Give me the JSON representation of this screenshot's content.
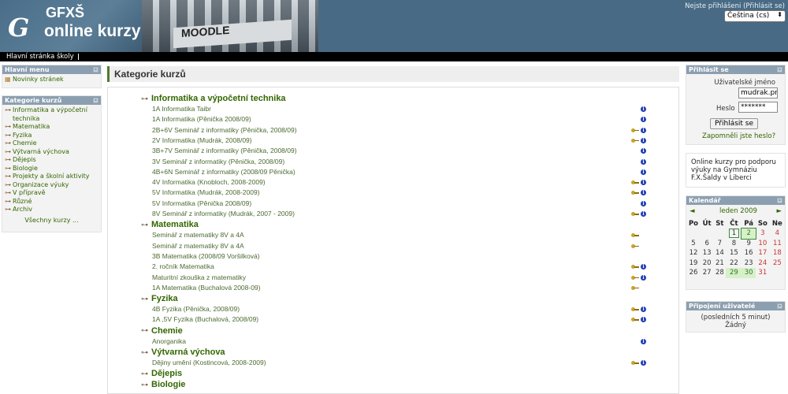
{
  "header": {
    "logo_line1": "GFXŠ",
    "logo_line2": "online kurzy",
    "logo_letter": "G",
    "photo_text": "MOODLE",
    "login_info": "Nejste přihlášeni (Přihlásit se)",
    "language": "Čeština (cs)"
  },
  "navbar": {
    "home_link": "Hlavní stránka školy"
  },
  "main_menu": {
    "title": "Hlavní menu",
    "items": [
      {
        "label": "Novinky stránek",
        "icon": "news-icon"
      }
    ]
  },
  "category_block": {
    "title": "Kategorie kurzů",
    "items": [
      "Informatika a výpočetní technika",
      "Matematika",
      "Fyzika",
      "Chemie",
      "Výtvarná výchova",
      "Dějepis",
      "Biologie",
      "Projekty a školní aktivity",
      "Organizace výuky",
      "V přípravě",
      "Různé",
      "Archiv"
    ],
    "all_courses": "Všechny kurzy ..."
  },
  "main": {
    "title": "Kategorie kurzů",
    "categories": [
      {
        "name": "Informatika a výpočetní technika",
        "courses": [
          {
            "name": "1A Informatika Taibr",
            "key": false,
            "info": true
          },
          {
            "name": "1A Informatika (Pěnička 2008/09)",
            "key": false,
            "info": true
          },
          {
            "name": "2B+6V Seminář z informatiky (Pěnička, 2008/09)",
            "key": true,
            "info": true
          },
          {
            "name": "2V Informatika (Mudrák, 2008/09)",
            "key": true,
            "info": true
          },
          {
            "name": "3B+7V Seminář z informatiky (Pěnička, 2008/09)",
            "key": false,
            "info": true
          },
          {
            "name": "3V Seminář z informatiky (Pěnička, 2008/09)",
            "key": false,
            "info": true
          },
          {
            "name": "4B+6N Seminář z informatiky (2008/09 Pěnička)",
            "key": false,
            "info": true
          },
          {
            "name": "4V Informatika (Knobloch, 2008-2009)",
            "key": true,
            "info": true
          },
          {
            "name": "5V Informatika (Mudrák, 2008-2009)",
            "key": true,
            "info": true
          },
          {
            "name": "5V Informatika (Pěnička 2008/09)",
            "key": false,
            "info": true
          },
          {
            "name": "8V Seminář z informatiky (Mudrák, 2007 - 2009)",
            "key": true,
            "info": true
          }
        ]
      },
      {
        "name": "Matematika",
        "courses": [
          {
            "name": "Seminář z matematiky 8V a 4A",
            "key": true,
            "info": false
          },
          {
            "name": "Seminář z matematiky 8V a 4A",
            "key": true,
            "info": false
          },
          {
            "name": "3B Matematika (2008/09 Voršilková)",
            "key": false,
            "info": false
          },
          {
            "name": "2. ročník Matematika",
            "key": true,
            "info": true
          },
          {
            "name": "Maturitní zkouška z matematiky",
            "key": true,
            "info": true
          },
          {
            "name": "1A Matematika (Buchalová 2008-09)",
            "key": true,
            "info": false
          }
        ]
      },
      {
        "name": "Fyzika",
        "courses": [
          {
            "name": "4B Fyzika (Pěnička, 2008/09)",
            "key": true,
            "info": true
          },
          {
            "name": "1A ,5V Fyzika (Buchalová, 2008/09)",
            "key": true,
            "info": true
          }
        ]
      },
      {
        "name": "Chemie",
        "courses": [
          {
            "name": "Anorganika",
            "key": false,
            "info": true
          }
        ]
      },
      {
        "name": "Výtvarná výchova",
        "courses": [
          {
            "name": "Dějiny umění (Kostincová, 2008-2009)",
            "key": true,
            "info": true
          }
        ]
      },
      {
        "name": "Dějepis",
        "courses": []
      },
      {
        "name": "Biologie",
        "courses": []
      }
    ]
  },
  "login_block": {
    "title": "Přihlásit se",
    "username_label": "Uživatelské jméno",
    "username_value": "mudrak.pr",
    "password_label": "Heslo",
    "password_value": "*******",
    "login_button": "Přihlásit se",
    "forgot_link": "Zapomněli jste heslo?"
  },
  "about_block": {
    "text": "Online kurzy pro podporu výuky na Gymnáziu F.X.Šaldy v Liberci"
  },
  "calendar": {
    "title": "Kalendář",
    "month": "leden 2009",
    "prev": "◄",
    "next": "►",
    "weekdays": [
      "Po",
      "Út",
      "St",
      "Čt",
      "Pá",
      "So",
      "Ne"
    ],
    "weeks": [
      [
        "",
        "",
        "",
        "1",
        "2",
        "3",
        "4"
      ],
      [
        "5",
        "6",
        "7",
        "8",
        "9",
        "10",
        "11"
      ],
      [
        "12",
        "13",
        "14",
        "15",
        "16",
        "17",
        "18"
      ],
      [
        "19",
        "20",
        "21",
        "22",
        "23",
        "24",
        "25"
      ],
      [
        "26",
        "27",
        "28",
        "29",
        "30",
        "31",
        ""
      ]
    ],
    "today": "1",
    "event_days": [
      "2",
      "29",
      "30"
    ]
  },
  "online_users": {
    "title": "Připojení uživatelé",
    "period": "(posledních 5 minut)",
    "none": "Žádný"
  },
  "colors": {
    "header": "#486a84",
    "block_header": "#8b9fb0",
    "link": "#336600",
    "accent": "#4f7b2f"
  }
}
